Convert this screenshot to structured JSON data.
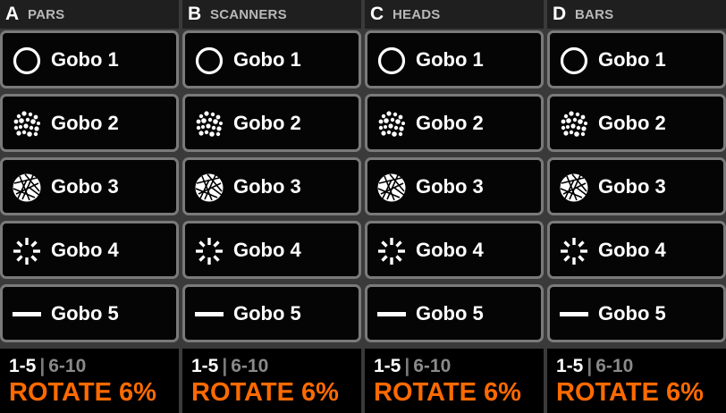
{
  "colors": {
    "background": "#3a3a3a",
    "button_bg": "#050505",
    "button_border": "#7a7a7a",
    "header_name": "#b8b8b8",
    "pager_inactive": "#8a8a8a",
    "rotate": "#ff6a00"
  },
  "gobo_icons": [
    "open-circle-icon",
    "dot-cluster-icon",
    "shattered-disc-icon",
    "starburst-icon",
    "bar-line-icon"
  ],
  "columns": [
    {
      "letter": "A",
      "name": "PARS",
      "gobos": [
        "Gobo 1",
        "Gobo 2",
        "Gobo 3",
        "Gobo 4",
        "Gobo 5"
      ],
      "pager": {
        "active": "1-5",
        "separator": "|",
        "inactive": "6-10"
      },
      "rotate": "ROTATE 6%"
    },
    {
      "letter": "B",
      "name": "SCANNERS",
      "gobos": [
        "Gobo 1",
        "Gobo 2",
        "Gobo 3",
        "Gobo 4",
        "Gobo 5"
      ],
      "pager": {
        "active": "1-5",
        "separator": "|",
        "inactive": "6-10"
      },
      "rotate": "ROTATE 6%"
    },
    {
      "letter": "C",
      "name": "HEADS",
      "gobos": [
        "Gobo 1",
        "Gobo 2",
        "Gobo 3",
        "Gobo 4",
        "Gobo 5"
      ],
      "pager": {
        "active": "1-5",
        "separator": "|",
        "inactive": "6-10"
      },
      "rotate": "ROTATE 6%"
    },
    {
      "letter": "D",
      "name": "BARS",
      "gobos": [
        "Gobo 1",
        "Gobo 2",
        "Gobo 3",
        "Gobo 4",
        "Gobo 5"
      ],
      "pager": {
        "active": "1-5",
        "separator": "|",
        "inactive": "6-10"
      },
      "rotate": "ROTATE 6%"
    }
  ]
}
